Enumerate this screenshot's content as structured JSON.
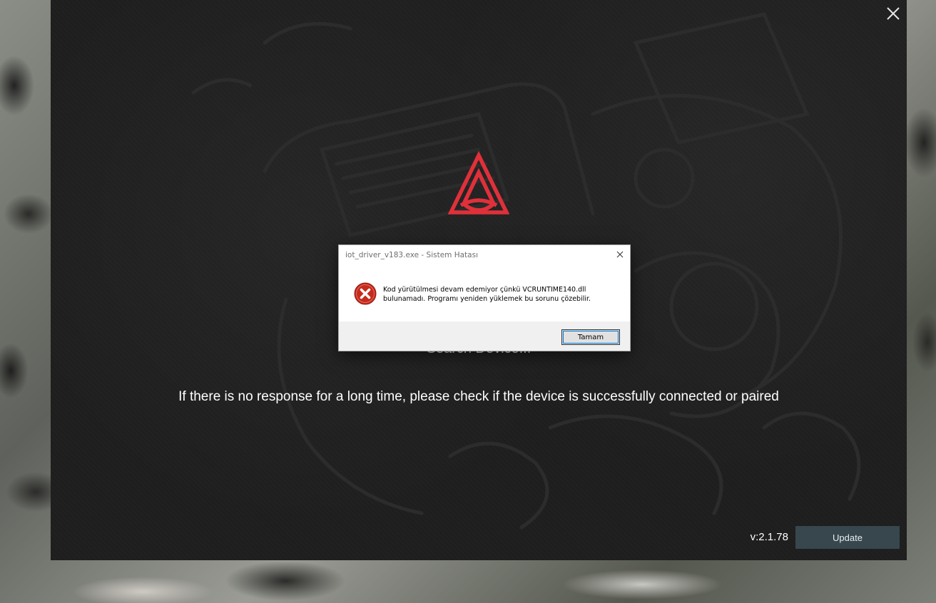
{
  "app": {
    "status_text": "Search Device...",
    "hint_text": "If there is no response for a long time, please check if the device is successfully connected or paired",
    "version": "v:2.1.78",
    "update_label": "Update",
    "close_icon": "close-icon",
    "logo_icon": "brand-logo-icon",
    "accent_color": "#e0303a",
    "update_button_color": "#37474d"
  },
  "dialog": {
    "title": "iot_driver_v183.exe - Sistem Hatası",
    "message_line1": "Kod yürütülmesi devam edemiyor çünkü VCRUNTIME140.dll",
    "message_line2": "bulunamadı. Programı yeniden yüklemek bu sorunu çözebilir.",
    "ok_label": "Tamam",
    "icon": "error-icon",
    "close_icon": "close-icon"
  }
}
